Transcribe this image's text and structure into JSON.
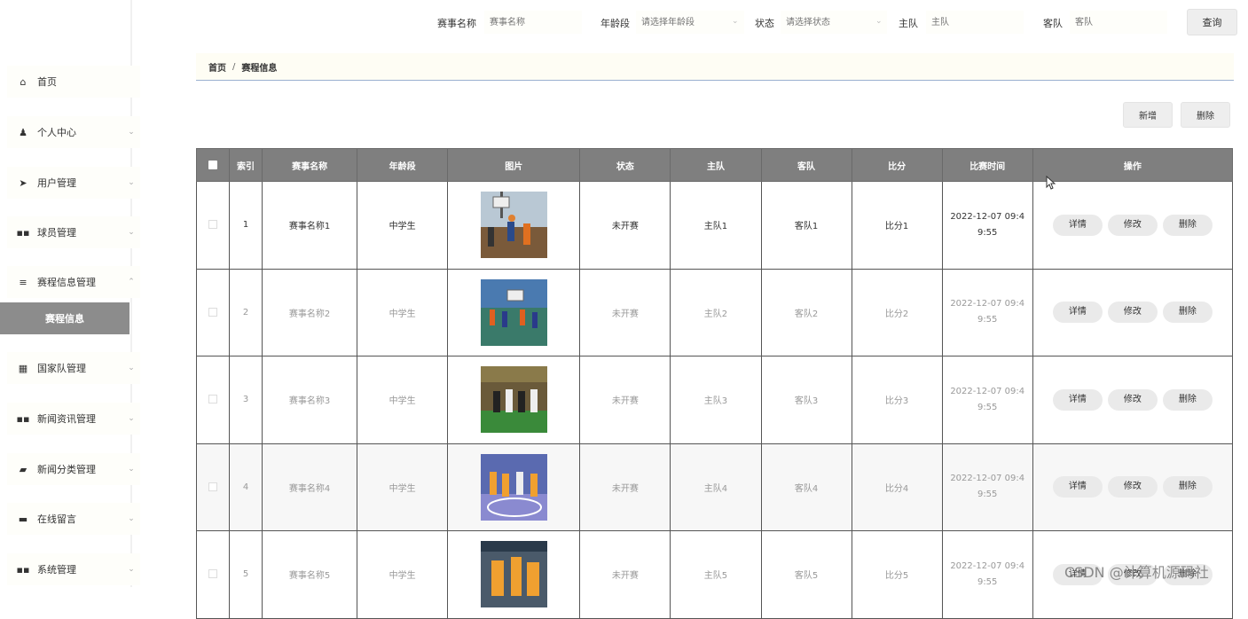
{
  "sidebar": {
    "items": [
      {
        "label": "首页",
        "icon": "home-icon",
        "glyph": "⌂",
        "chevron": ""
      },
      {
        "label": "个人中心",
        "icon": "user-icon",
        "glyph": "♟",
        "chevron": "⌄"
      },
      {
        "label": "用户管理",
        "icon": "send-icon",
        "glyph": "➤",
        "chevron": "⌄"
      },
      {
        "label": "球员管理",
        "icon": "grid-icon",
        "glyph": "▪▪",
        "chevron": "⌄"
      },
      {
        "label": "赛程信息管理",
        "icon": "list-icon",
        "glyph": "≡",
        "chevron": "⌃"
      },
      {
        "label": "国家队管理",
        "icon": "apps-icon",
        "glyph": "▦",
        "chevron": "⌄"
      },
      {
        "label": "新闻资讯管理",
        "icon": "grid-icon",
        "glyph": "▪▪",
        "chevron": "⌄"
      },
      {
        "label": "新闻分类管理",
        "icon": "folder-icon",
        "glyph": "▰",
        "chevron": "⌄"
      },
      {
        "label": "在线留言",
        "icon": "message-icon",
        "glyph": "▬",
        "chevron": "⌄"
      },
      {
        "label": "系统管理",
        "icon": "grid-icon",
        "glyph": "▪▪",
        "chevron": "⌄"
      }
    ],
    "active_sub": "赛程信息"
  },
  "search": {
    "name_label": "赛事名称",
    "name_placeholder": "赛事名称",
    "age_label": "年龄段",
    "age_placeholder": "请选择年龄段",
    "status_label": "状态",
    "status_placeholder": "请选择状态",
    "home_label": "主队",
    "home_placeholder": "主队",
    "away_label": "客队",
    "away_placeholder": "客队",
    "query_label": "查询"
  },
  "breadcrumb": {
    "home": "首页",
    "sep": "/",
    "current": "赛程信息"
  },
  "toolbar": {
    "add_label": "新增",
    "delete_label": "删除"
  },
  "table": {
    "headers": [
      "索引",
      "赛事名称",
      "年龄段",
      "图片",
      "状态",
      "主队",
      "客队",
      "比分",
      "比赛时间",
      "操作"
    ],
    "rows": [
      {
        "index": "1",
        "name": "赛事名称1",
        "age": "中学生",
        "status": "未开赛",
        "home": "主队1",
        "away": "客队1",
        "score": "比分1",
        "time1": "2022-12-07 09:4",
        "time2": "9:55"
      },
      {
        "index": "2",
        "name": "赛事名称2",
        "age": "中学生",
        "status": "未开赛",
        "home": "主队2",
        "away": "客队2",
        "score": "比分2",
        "time1": "2022-12-07 09:4",
        "time2": "9:55"
      },
      {
        "index": "3",
        "name": "赛事名称3",
        "age": "中学生",
        "status": "未开赛",
        "home": "主队3",
        "away": "客队3",
        "score": "比分3",
        "time1": "2022-12-07 09:4",
        "time2": "9:55"
      },
      {
        "index": "4",
        "name": "赛事名称4",
        "age": "中学生",
        "status": "未开赛",
        "home": "主队4",
        "away": "客队4",
        "score": "比分4",
        "time1": "2022-12-07 09:4",
        "time2": "9:55"
      },
      {
        "index": "5",
        "name": "赛事名称5",
        "age": "中学生",
        "status": "未开赛",
        "home": "主队5",
        "away": "客队5",
        "score": "比分5",
        "time1": "2022-12-07 09:4",
        "time2": "9:55"
      }
    ],
    "actions": {
      "detail": "详情",
      "edit": "修改",
      "delete": "删除"
    }
  },
  "watermark": "CSDN @计算机源码社"
}
